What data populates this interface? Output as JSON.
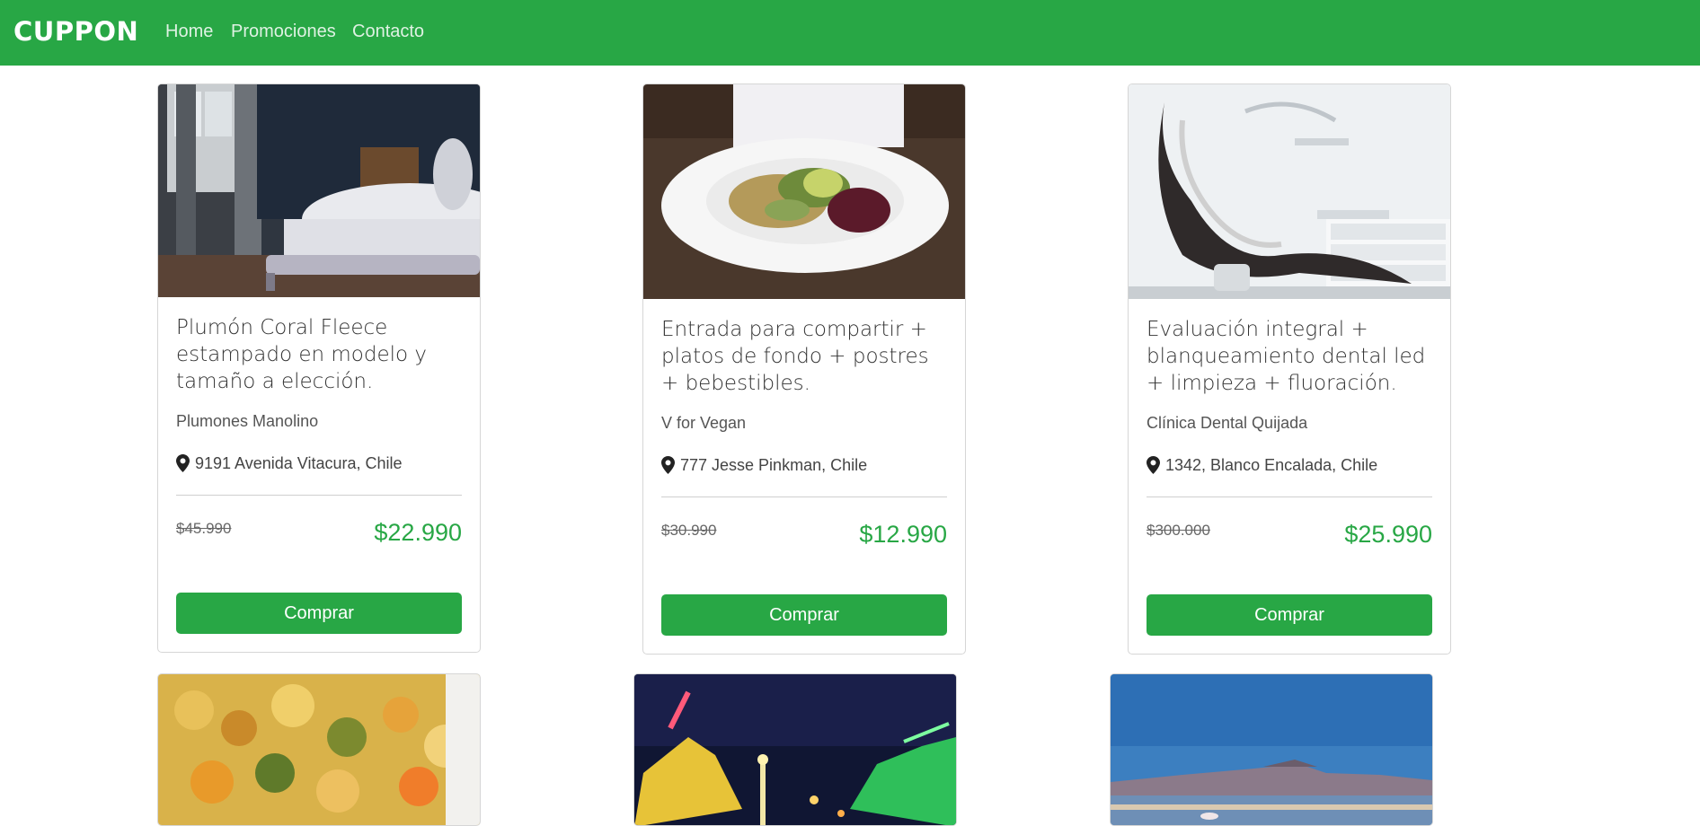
{
  "navbar": {
    "brand": "CUPPON",
    "links": [
      "Home",
      "Promociones",
      "Contacto"
    ],
    "bg_color": "#28a745"
  },
  "cards": [
    {
      "image": "bedroom-bed-photo",
      "title": "Plumón Coral Fleece estampado en modelo y tamaño a elección.",
      "merchant": "Plumones Manolino",
      "location": "9191 Avenida Vitacura, Chile",
      "old_price": "$45.990",
      "new_price": "$22.990",
      "button": "Comprar"
    },
    {
      "image": "vegan-salad-plate-photo",
      "title": "Entrada para compartir + platos de fondo + postres + bebestibles.",
      "merchant": "V for Vegan",
      "location": "777 Jesse Pinkman, Chile",
      "old_price": "$30.990",
      "new_price": "$12.990",
      "button": "Comprar"
    },
    {
      "image": "dental-chair-photo",
      "title": "Evaluación integral + blanqueamiento dental led + limpieza + fluoración.",
      "merchant": "Clínica Dental Quijada",
      "location": "1342, Blanco Encalada, Chile",
      "old_price": "$300.000",
      "new_price": "$25.990",
      "button": "Comprar"
    },
    {
      "image": "pasta-dish-photo"
    },
    {
      "image": "amusement-park-night-photo"
    },
    {
      "image": "lake-mountain-landscape-photo"
    }
  ],
  "colors": {
    "accent": "#28a745",
    "price": "#28a745"
  },
  "icons": {
    "location": "map-marker-icon"
  }
}
